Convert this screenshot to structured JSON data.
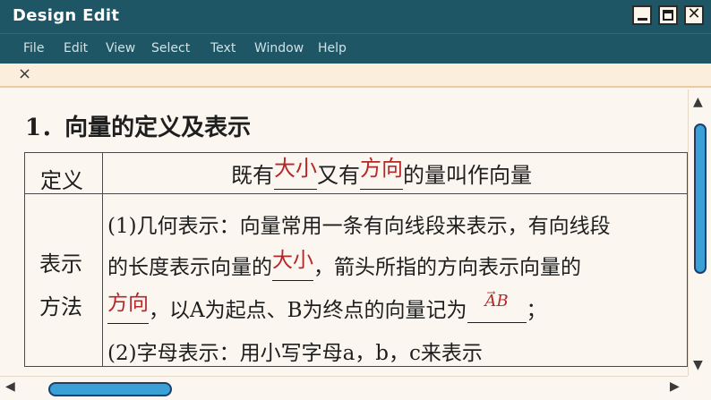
{
  "window": {
    "title": "Design Edit"
  },
  "menu": [
    "File",
    "Edit",
    "View",
    "Select",
    "Text",
    "Window",
    "Help"
  ],
  "tab": {
    "close_glyph": "×"
  },
  "heading": "1．向量的定义及表示",
  "table": {
    "definition": {
      "label": "定义",
      "prefix": "既有",
      "answer1": "大小",
      "middle": "又有",
      "answer2": "方向",
      "suffix": "的量叫作向量"
    },
    "representation": {
      "label_line1": "表示",
      "label_line2": "方法",
      "line1": "(1)几何表示：向量常用一条有向线段来表示，有向线段",
      "line2_prefix": "的长度表示向量的",
      "line2_answer": "大小",
      "line2_suffix": "，箭头所指的方向表示向量的",
      "line3_answer": "方向",
      "line3_middle": "，以A为起点、B为终点的向量记为",
      "line3_vector": "AB",
      "line3_end": "；",
      "line4": "(2)字母表示：用小写字母a，b，c来表示"
    }
  },
  "colors": {
    "titlebar": "#1f5666",
    "answer": "#b5282a",
    "scroll_thumb": "#3aa0d6"
  }
}
